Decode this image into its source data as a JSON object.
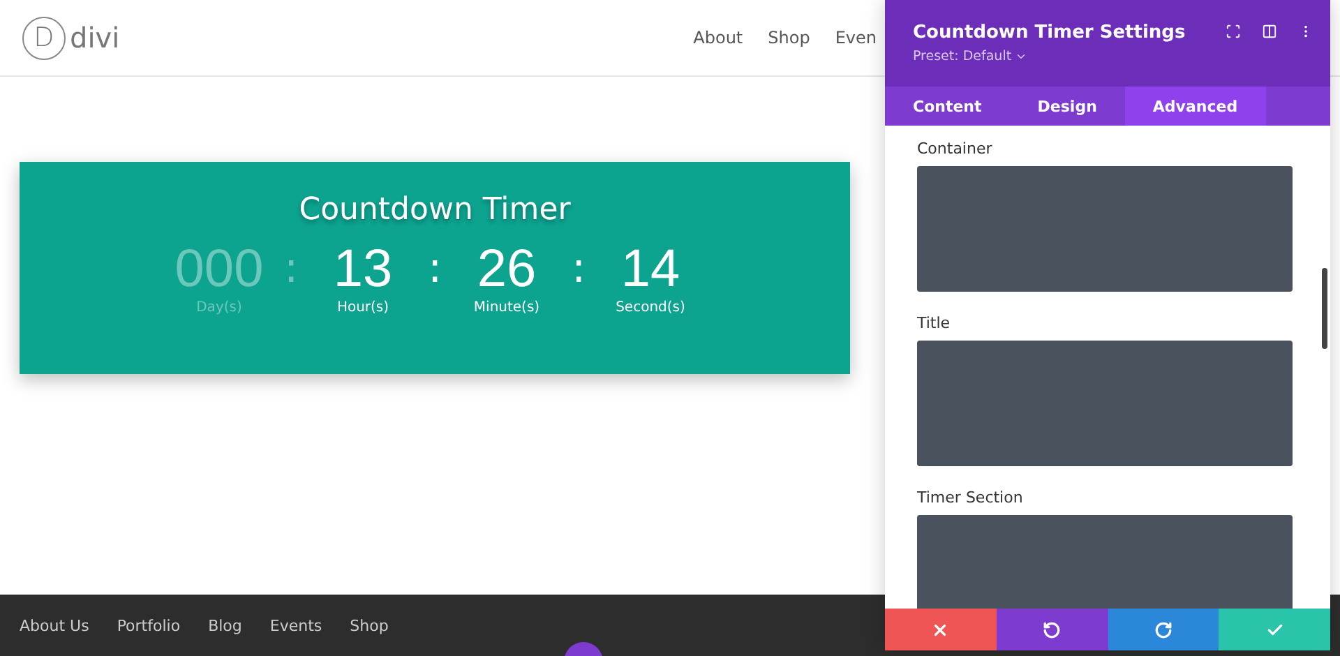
{
  "site": {
    "logo_letter": "D",
    "logo_text": "divi",
    "nav": [
      "About",
      "Shop",
      "Even"
    ]
  },
  "timer": {
    "title": "Countdown Timer",
    "units": [
      {
        "value": "000",
        "label": "Day(s)",
        "dimmed": true
      },
      {
        "value": "13",
        "label": "Hour(s)",
        "dimmed": false
      },
      {
        "value": "26",
        "label": "Minute(s)",
        "dimmed": false
      },
      {
        "value": "14",
        "label": "Second(s)",
        "dimmed": false
      }
    ],
    "separator": ":"
  },
  "footer": {
    "links": [
      "About Us",
      "Portfolio",
      "Blog",
      "Events",
      "Shop"
    ]
  },
  "settings": {
    "title": "Countdown Timer Settings",
    "preset": "Preset: Default",
    "tabs": [
      {
        "label": "Content",
        "selected": false
      },
      {
        "label": "Design",
        "selected": false
      },
      {
        "label": "Advanced",
        "selected": true
      }
    ],
    "sections": [
      "Container",
      "Title",
      "Timer Section"
    ],
    "actions": [
      {
        "kind": "cancel",
        "color": "#ef5555"
      },
      {
        "kind": "undo",
        "color": "#7e3bd0"
      },
      {
        "kind": "redo",
        "color": "#2b87da"
      },
      {
        "kind": "save",
        "color": "#29c4a9"
      }
    ]
  }
}
